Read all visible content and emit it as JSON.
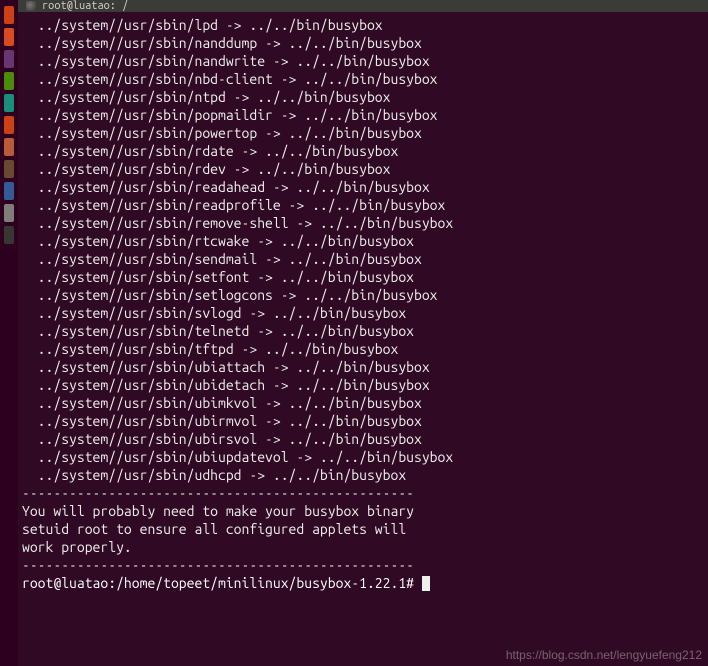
{
  "window": {
    "title": "root@luatao: /"
  },
  "launcher": {
    "colors": [
      "#dd4814",
      "#e95420",
      "#6d3b7b",
      "#4e9a06",
      "#169f85",
      "#dd4814",
      "#c9643b",
      "#6f5233",
      "#3465a4",
      "#888a85",
      "#3c3b37"
    ]
  },
  "terminal": {
    "indent": "  ",
    "src_prefix": "../system//usr/sbin/",
    "dst": "../../bin/busybox",
    "links": [
      "lpd",
      "nanddump",
      "nandwrite",
      "nbd-client",
      "ntpd",
      "popmaildir",
      "powertop",
      "rdate",
      "rdev",
      "readahead",
      "readprofile",
      "remove-shell",
      "rtcwake",
      "sendmail",
      "setfont",
      "setlogcons",
      "svlogd",
      "telnetd",
      "tftpd",
      "ubiattach",
      "ubidetach",
      "ubimkvol",
      "ubirmvol",
      "ubirsvol",
      "ubiupdatevol",
      "udhcpd"
    ],
    "sep": "--------------------------------------------------",
    "msg1": "You will probably need to make your busybox binary",
    "msg2": "setuid root to ensure all configured applets will",
    "msg3": "work properly.",
    "prompt": "root@luatao:/home/topeet/minilinux/busybox-1.22.1#"
  },
  "watermark": "https://blog.csdn.net/lengyuefeng212"
}
